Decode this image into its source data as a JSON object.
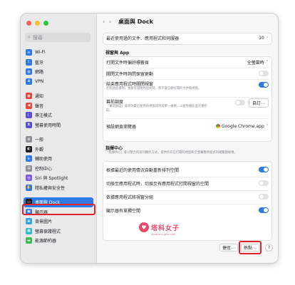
{
  "window": {
    "title": "桌面與 Dock"
  },
  "sidebar": {
    "search_placeholder": "搜尋",
    "groups": [
      [
        {
          "label": "Wi-Fi",
          "icon": "wifi-icon",
          "color": "#2f7ae5",
          "glyph": "≋"
        },
        {
          "label": "藍牙",
          "icon": "bluetooth-icon",
          "color": "#2f7ae5",
          "glyph": "ᛒ"
        },
        {
          "label": "網路",
          "icon": "globe-icon",
          "color": "#2f7ae5",
          "glyph": "◍"
        },
        {
          "label": "VPN",
          "icon": "vpn-icon",
          "color": "#2f7ae5",
          "glyph": "⊕"
        }
      ],
      [
        {
          "label": "通知",
          "icon": "bell-icon",
          "color": "#e5483d",
          "glyph": "◉"
        },
        {
          "label": "聲音",
          "icon": "speaker-icon",
          "color": "#e5483d",
          "glyph": "◀"
        },
        {
          "label": "專注模式",
          "icon": "moon-icon",
          "color": "#5b4fd6",
          "glyph": "☾"
        },
        {
          "label": "螢幕使用時間",
          "icon": "hourglass-icon",
          "color": "#5b4fd6",
          "glyph": "⧗"
        }
      ],
      [
        {
          "label": "一般",
          "icon": "gear-icon",
          "color": "#8e8e93",
          "glyph": "⚙"
        },
        {
          "label": "外觀",
          "icon": "appearance-icon",
          "color": "#1d1d1f",
          "glyph": "◐"
        },
        {
          "label": "輔助使用",
          "icon": "accessibility-icon",
          "color": "#2f7ae5",
          "glyph": "♿"
        },
        {
          "label": "控制中心",
          "icon": "control-center-icon",
          "color": "#8e8e93",
          "glyph": "▤"
        },
        {
          "label": "Siri 與 Spotlight",
          "icon": "siri-icon",
          "color": "#7b5be0",
          "glyph": "◎"
        },
        {
          "label": "隱私權與安全性",
          "icon": "hand-icon",
          "color": "#2f7ae5",
          "glyph": "✋"
        }
      ],
      [
        {
          "label": "桌面與 Dock",
          "icon": "dock-icon",
          "color": "#1d1d1f",
          "glyph": "▭",
          "selected": true
        },
        {
          "label": "顯示器",
          "icon": "display-icon",
          "color": "#2f7ae5",
          "glyph": "▣"
        },
        {
          "label": "背景圖片",
          "icon": "wallpaper-icon",
          "color": "#35a8e0",
          "glyph": "❀"
        },
        {
          "label": "螢幕保護程式",
          "icon": "screensaver-icon",
          "color": "#35b8c8",
          "glyph": "▦"
        },
        {
          "label": "能源節約器",
          "icon": "battery-icon",
          "color": "#3cba54",
          "glyph": "▬"
        }
      ]
    ]
  },
  "main": {
    "recent_row": {
      "label": "最近使用過的文件、應用程式和伺服器",
      "value": "10"
    },
    "windows_section": "視窗與 App",
    "prefer_tabs": {
      "label": "打開文件時偏好標籤頁",
      "value": "全螢幕時"
    },
    "ask_keep_changes": {
      "label": "關閉文件時詢問保留更動",
      "on": false
    },
    "close_windows": {
      "label": "結束應用程式時關閉視窗",
      "desc": "若開啟此選項，重新打開應用程式時，將不會自動打開的文件和視窗。",
      "on": true
    },
    "stage_manager": {
      "label": "幕前調度",
      "desc": "「幕前調度」會將你最近使用的視窗排列成單一檢視，以避免雜亂並方便存取。",
      "on": false,
      "button": "自訂⋯"
    },
    "default_browser": {
      "label": "預設網頁瀏覽器",
      "value": "Google Chrome.app"
    },
    "mission_section": "指揮中心",
    "mission_desc": "「指揮中心」會以整合的排列顯示方式，提供所有已打開的視窗和全螢幕應用程式的縮覽圖檢視。",
    "auto_rearrange": {
      "label": "根據最近的使用情況自動重新排列空間",
      "on": true
    },
    "switch_space": {
      "label": "切換至應用程式時，切換至有應用程式打開視窗的空間",
      "on": false
    },
    "group_windows": {
      "label": "依據應用程式將視窗分組",
      "on": false
    },
    "separate_spaces": {
      "label": "顯示器有單獨空間",
      "on": true
    },
    "shortcuts_button": "捷徑⋯",
    "hot_corners_button": "熱點⋯",
    "help": "?"
  },
  "watermark": {
    "name": "塔科女子",
    "url": "www.tech-girlz.com"
  },
  "colors": {
    "accent": "#2f7ae5",
    "highlight_red": "#e3232c"
  }
}
